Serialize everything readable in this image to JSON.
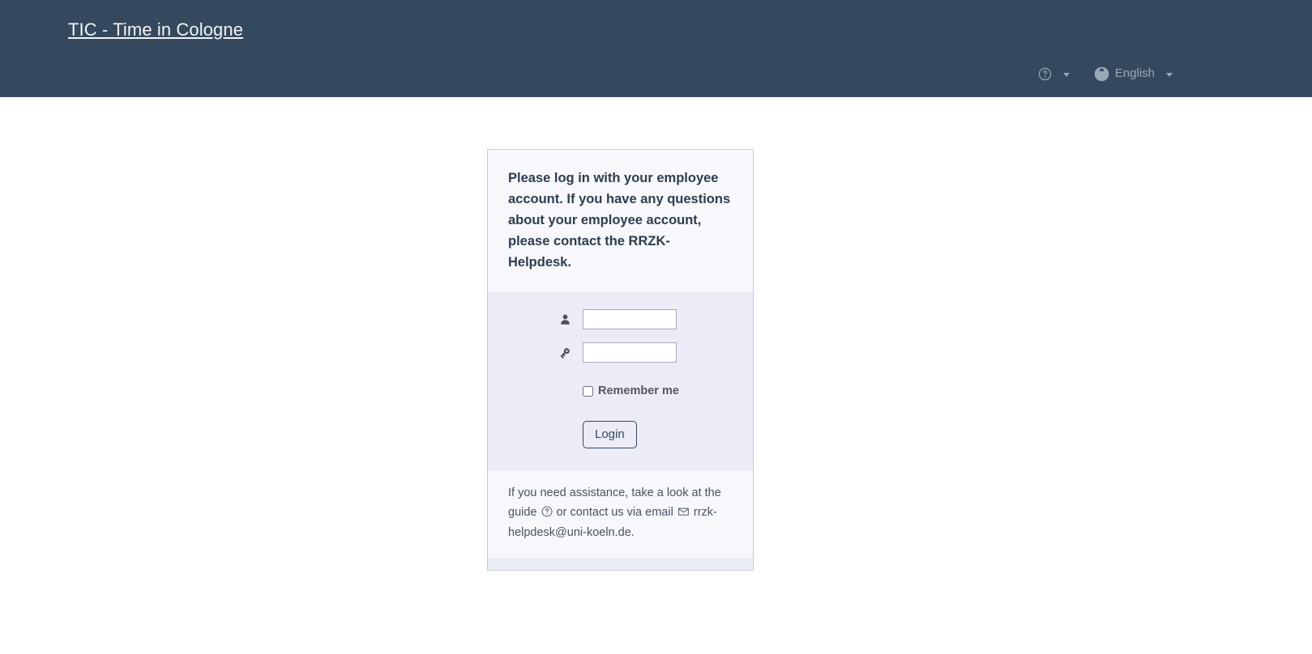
{
  "header": {
    "brand_title": "TIC - Time in Cologne",
    "help_icon": "question-circle-icon",
    "globe_icon": "globe-icon",
    "language_label": "English",
    "background_color": "#34495e",
    "text_color": "#9aa9b8"
  },
  "login_card": {
    "message": "Please log in with your employee account. If you have any questions about your employee account, please contact the RRZK-Helpdesk.",
    "username": {
      "icon": "person-icon",
      "value": "",
      "placeholder": ""
    },
    "password": {
      "icon": "key-icon",
      "value": "",
      "placeholder": ""
    },
    "remember_me": {
      "label": "Remember me",
      "checked": false
    },
    "login_button_label": "Login",
    "footer": {
      "text_before_guide": "If you need assistance, take a look at the guide",
      "guide_icon": "question-circle-icon",
      "text_between": "or contact us via email",
      "email_icon": "envelope-icon",
      "email": "rrzk-helpdesk@uni-koeln.de."
    },
    "accent_color": "#34495e",
    "card_background": "#f6f6fc",
    "body_background": "#ececf7"
  }
}
